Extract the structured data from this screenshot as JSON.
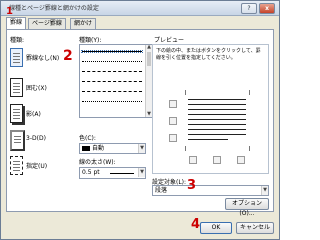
{
  "window": {
    "title": "線種とページ罫線と網かけの設定",
    "help": "?",
    "close": "x"
  },
  "tabs": [
    {
      "label": "罫線"
    },
    {
      "label": "ページ罫線"
    },
    {
      "label": "網かけ"
    }
  ],
  "left": {
    "section_label": "種類:",
    "presets": [
      {
        "label": "罫線なし(N)"
      },
      {
        "label": "囲む(X)"
      },
      {
        "label": "影(A)"
      },
      {
        "label": "3-D(D)"
      },
      {
        "label": "指定(U)"
      }
    ]
  },
  "middle": {
    "style_label": "種類(Y):",
    "color_label": "色(C):",
    "color_value": "自動",
    "width_label": "線の太さ(W):",
    "width_value": "0.5 pt"
  },
  "right": {
    "preview_label": "プレビュー",
    "preview_help": "下の絵の中、またはボタンをクリックして、罫線を引く位置を指定してください。",
    "apply_label": "設定対象(L):",
    "apply_value": "段落",
    "options_button": "オプション(O)..."
  },
  "footer": {
    "ok": "OK",
    "cancel": "キャンセル"
  },
  "annotations": [
    "1",
    "2",
    "3",
    "4"
  ],
  "colors": {
    "annotation": "#cc0000",
    "accent": "#3a6fb0"
  }
}
